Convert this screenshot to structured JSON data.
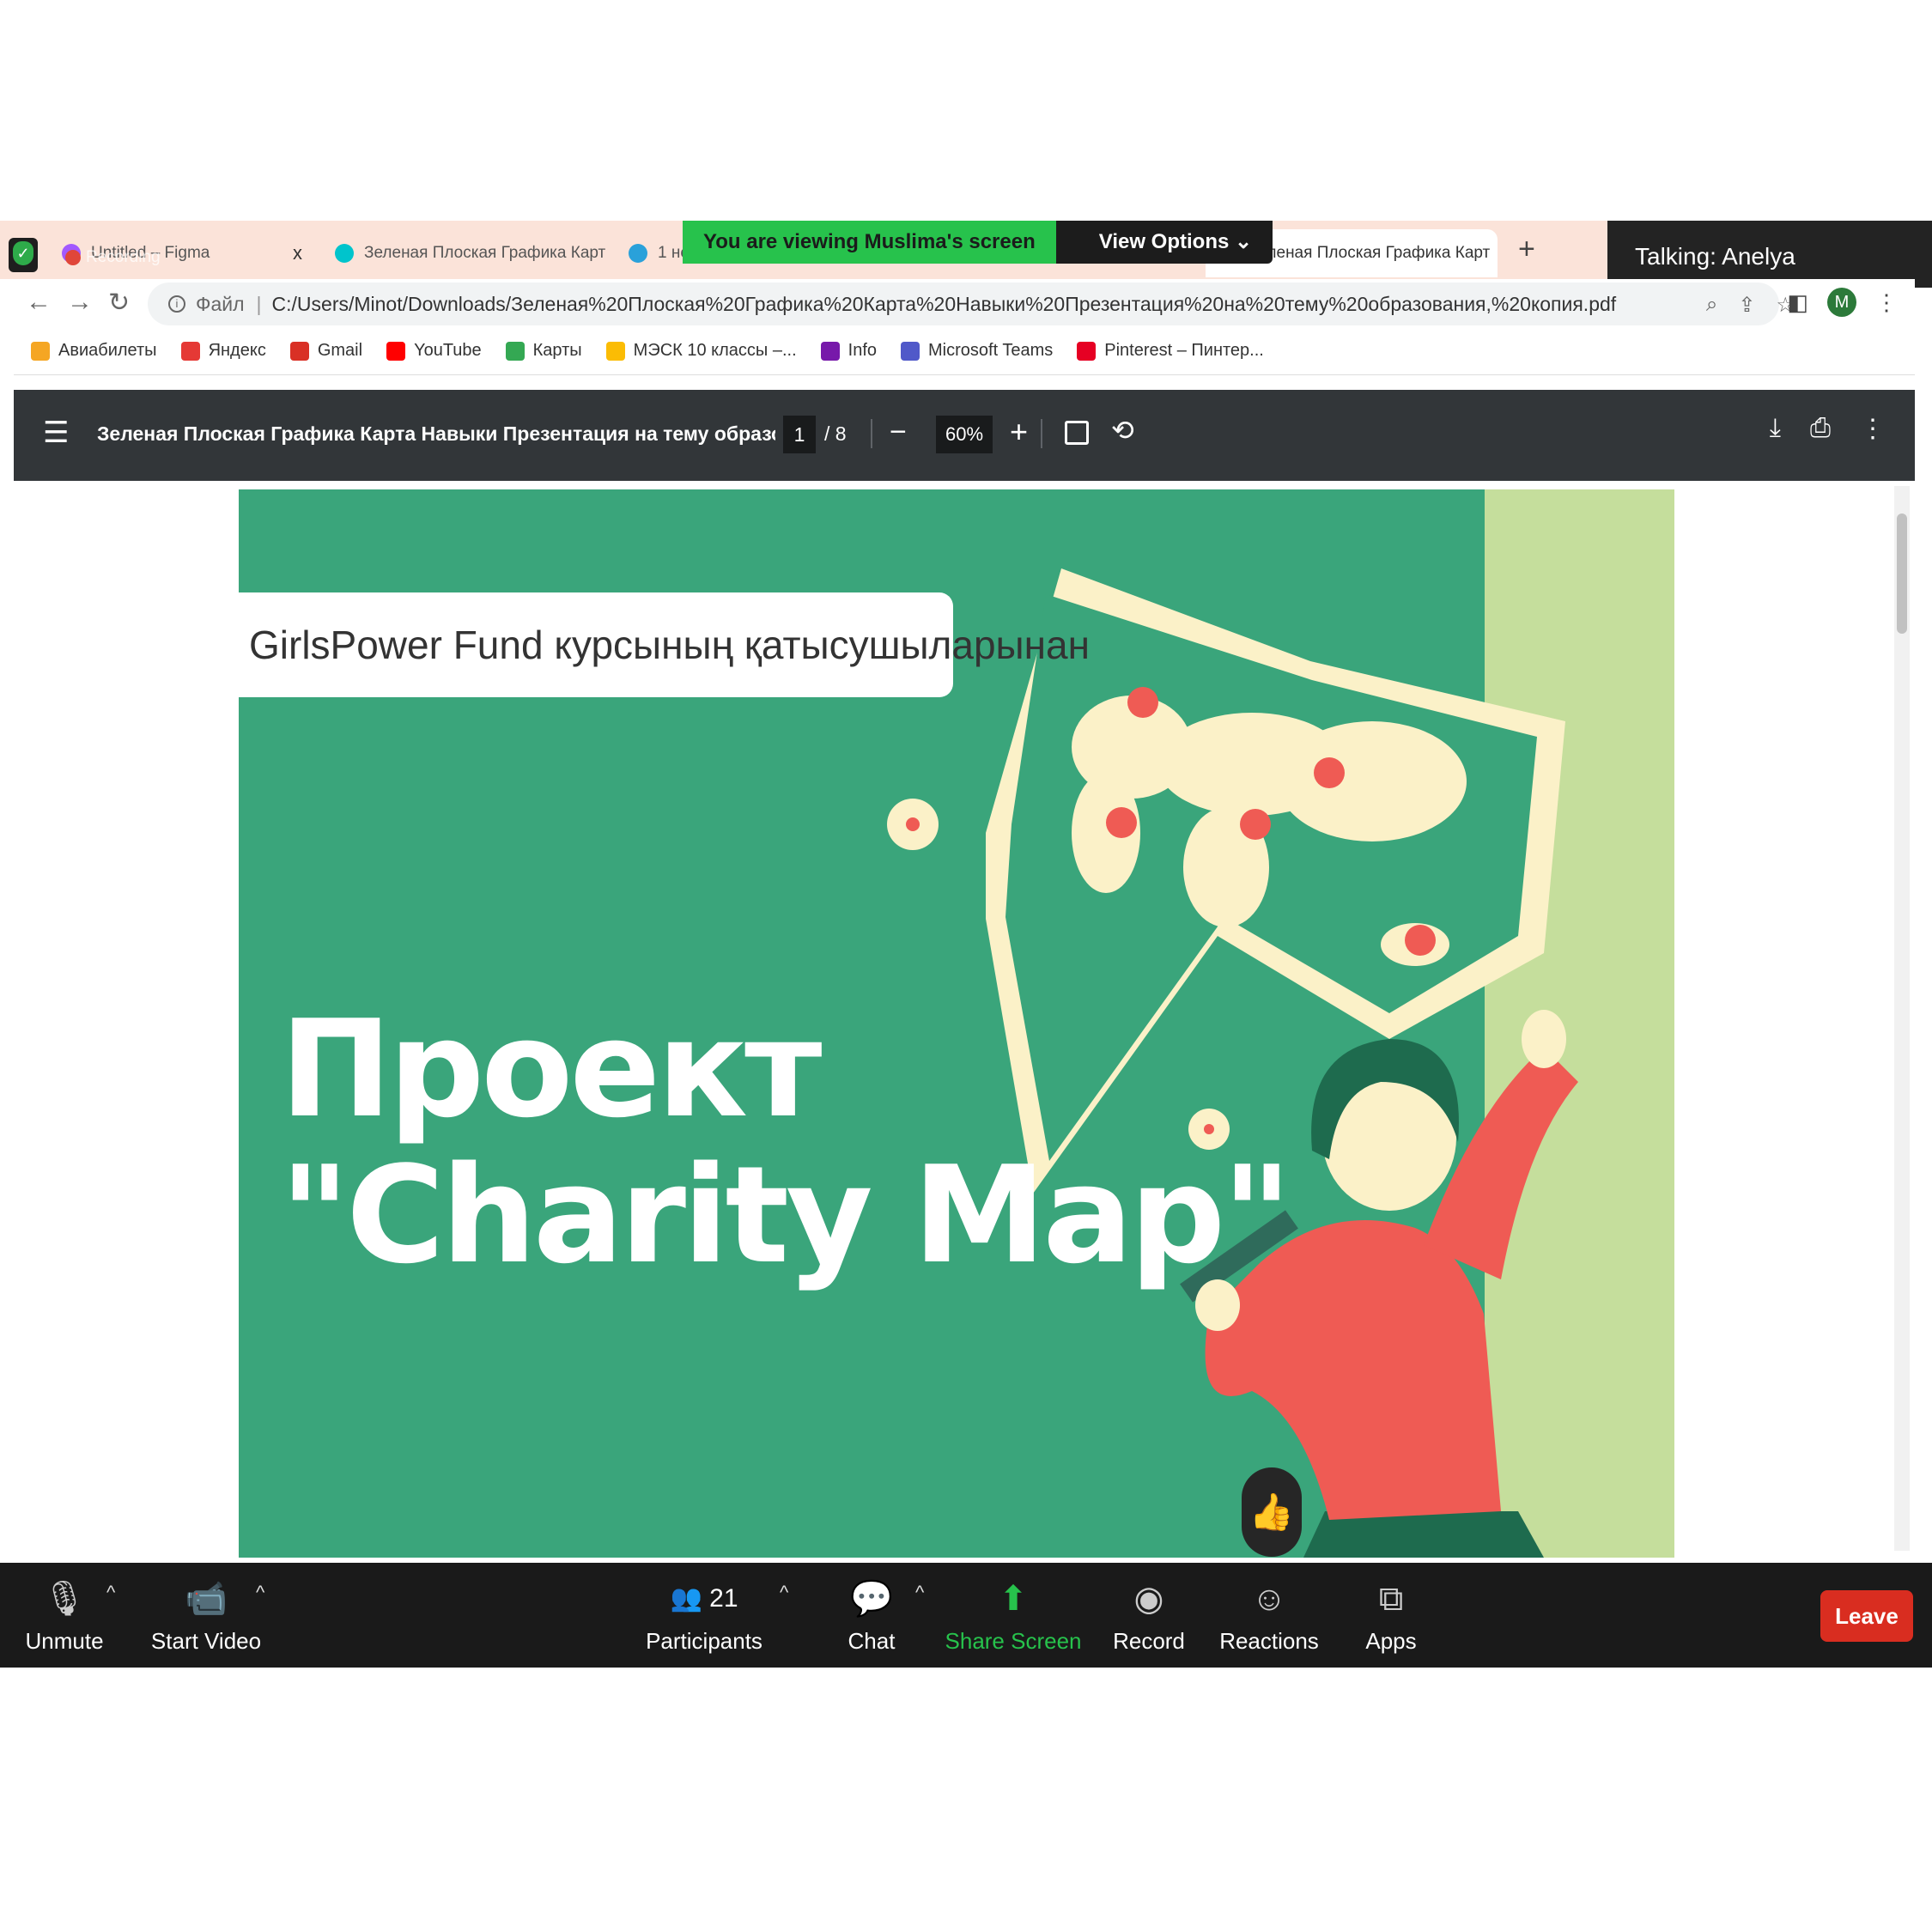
{
  "recording": {
    "label": "Recording"
  },
  "tabs": [
    {
      "label": "Untitled – Figma",
      "close": "x"
    },
    {
      "label": "Зеленая Плоская Графика Карт",
      "close": "x"
    },
    {
      "label": "1 не",
      "close": ""
    },
    {
      "label": "Зеленая Плоская Графика Карт",
      "close": "x"
    }
  ],
  "new_tab": "+",
  "zoom_banner": {
    "viewing": "You are viewing Muslima's screen",
    "view_options": "View Options ⌄"
  },
  "talking": "Talking: Anelya",
  "address": {
    "label": "Файл",
    "url": "C:/Users/Minot/Downloads/Зеленая%20Плоская%20Графика%20Карта%20Навыки%20Презентация%20на%20тему%20образования,%20копия.pdf"
  },
  "profile_initial": "M",
  "bookmarks": [
    {
      "label": "Авиабилеты",
      "color": "#f5a623"
    },
    {
      "label": "Яндекс",
      "color": "#e53935"
    },
    {
      "label": "Gmail",
      "color": "#d93025"
    },
    {
      "label": "YouTube",
      "color": "#ff0000"
    },
    {
      "label": "Карты",
      "color": "#34a853"
    },
    {
      "label": "МЭСК 10 классы –...",
      "color": "#fbbc04"
    },
    {
      "label": "Info",
      "color": "#7719aa"
    },
    {
      "label": "Microsoft Teams",
      "color": "#5059c9"
    },
    {
      "label": "Pinterest – Пинтер...",
      "color": "#e60023"
    }
  ],
  "pdf": {
    "title": "Зеленая Плоская Графика Карта Навыки Презентация на тему образования, к...",
    "page": "1",
    "total": "/  8",
    "zoom": "60%"
  },
  "slide": {
    "subtitle": "GirlsPower Fund курсының қатысушыларынан",
    "title_line1": "Проект",
    "title_line2": "\"Charity Map\""
  },
  "zoom_toolbar": {
    "unmute": "Unmute",
    "start_video": "Start Video",
    "participants": "Participants",
    "participants_count": "21",
    "chat": "Chat",
    "share_screen": "Share Screen",
    "record": "Record",
    "reactions": "Reactions",
    "apps": "Apps",
    "leave": "Leave"
  },
  "colors": {
    "slide_green": "#3aa57b",
    "accent_green": "#27c24c",
    "leave_red": "#d92d20"
  }
}
